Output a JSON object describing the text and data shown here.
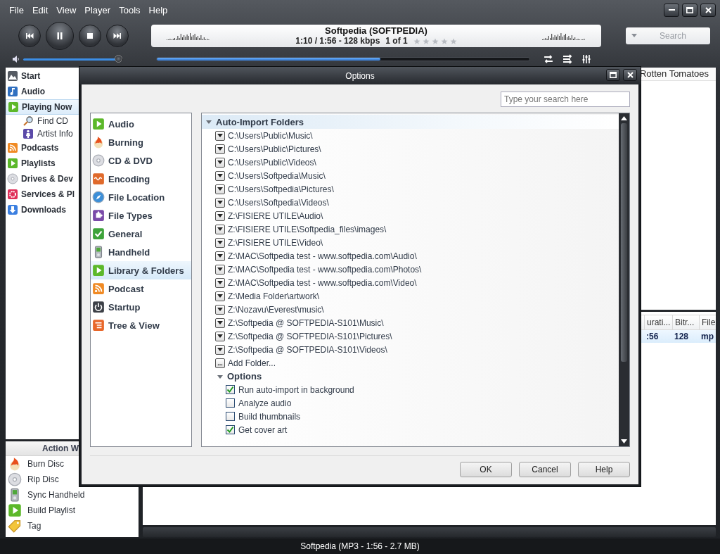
{
  "menu": [
    "File",
    "Edit",
    "View",
    "Player",
    "Tools",
    "Help"
  ],
  "now_playing": {
    "title": "Softpedia (SOFTPEDIA)",
    "time": "1:10 / 1:56 - 128 kbps",
    "position": "1 of 1",
    "stars": 0
  },
  "search": {
    "placeholder": "Search"
  },
  "volume": {
    "level": 0.95
  },
  "seek": {
    "level": 0.6
  },
  "sidebar": {
    "items": [
      {
        "label": "Start",
        "selected": false
      },
      {
        "label": "Audio",
        "selected": false
      },
      {
        "label": "Playing Now",
        "selected": true,
        "children": [
          {
            "label": "Find CD",
            "selected": false
          },
          {
            "label": "Artist Info",
            "selected": false
          }
        ]
      },
      {
        "label": "Podcasts",
        "selected": false
      },
      {
        "label": "Playlists",
        "selected": false
      },
      {
        "label": "Drives & Dev",
        "selected": false
      },
      {
        "label": "Services & Pl",
        "selected": false
      },
      {
        "label": "Downloads",
        "selected": false
      }
    ]
  },
  "action_window": {
    "title": "Action W",
    "items": [
      "Burn Disc",
      "Rip Disc",
      "Sync Handheld",
      "Build Playlist",
      "Tag"
    ]
  },
  "content": {
    "tab": "Rotten Tomatoes",
    "table": {
      "columns": [
        "urati...",
        "Bitr...",
        "File"
      ],
      "rows": [
        {
          "cells": [
            ":56",
            "128",
            "mp"
          ],
          "selected": true
        }
      ]
    }
  },
  "status_bar": "Softpedia (MP3 - 1:56 - 2.7 MB)",
  "dialog": {
    "title": "Options",
    "search": {
      "placeholder": "Type your search here"
    },
    "categories": [
      {
        "label": "Audio",
        "selected": false
      },
      {
        "label": "Burning",
        "selected": false
      },
      {
        "label": "CD & DVD",
        "selected": false
      },
      {
        "label": "Encoding",
        "selected": false
      },
      {
        "label": "File Location",
        "selected": false
      },
      {
        "label": "File Types",
        "selected": false
      },
      {
        "label": "General",
        "selected": false
      },
      {
        "label": "Handheld",
        "selected": false
      },
      {
        "label": "Library & Folders",
        "selected": true
      },
      {
        "label": "Podcast",
        "selected": false
      },
      {
        "label": "Startup",
        "selected": false
      },
      {
        "label": "Tree & View",
        "selected": false
      }
    ],
    "section": {
      "title": "Auto-Import Folders",
      "expanded": true,
      "folders": [
        "C:\\Users\\Public\\Music\\",
        "C:\\Users\\Public\\Pictures\\",
        "C:\\Users\\Public\\Videos\\",
        "C:\\Users\\Softpedia\\Music\\",
        "C:\\Users\\Softpedia\\Pictures\\",
        "C:\\Users\\Softpedia\\Videos\\",
        "Z:\\FISIERE UTILE\\Audio\\",
        "Z:\\FISIERE UTILE\\Softpedia_files\\images\\",
        "Z:\\FISIERE UTILE\\Video\\",
        "Z:\\MAC\\Softpedia test - www.softpedia.com\\Audio\\",
        "Z:\\MAC\\Softpedia test - www.softpedia.com\\Photos\\",
        "Z:\\MAC\\Softpedia test - www.softpedia.com\\Video\\",
        "Z:\\Media Folder\\artwork\\",
        "Z:\\Nozavu\\Everest\\music\\",
        "Z:\\Softpedia @ SOFTPEDIA-S101\\Music\\",
        "Z:\\Softpedia @ SOFTPEDIA-S101\\Pictures\\",
        "Z:\\Softpedia @ SOFTPEDIA-S101\\Videos\\"
      ],
      "add_folder": {
        "button": "...",
        "label": "Add Folder..."
      },
      "options": {
        "title": "Options",
        "expanded": true,
        "items": [
          {
            "label": "Run auto-import in background",
            "checked": true
          },
          {
            "label": "Analyze audio",
            "checked": false
          },
          {
            "label": "Build thumbnails",
            "checked": false
          },
          {
            "label": "Get cover art",
            "checked": true
          }
        ]
      }
    },
    "buttons": [
      "OK",
      "Cancel",
      "Help"
    ]
  }
}
